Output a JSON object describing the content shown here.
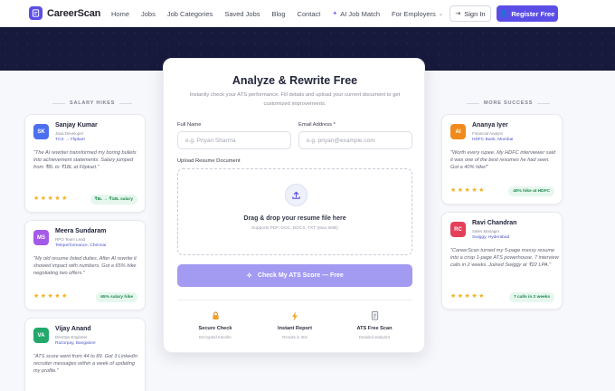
{
  "brand": {
    "name": "CareerScan"
  },
  "nav": {
    "links": [
      "Home",
      "Jobs",
      "Job Categories",
      "Saved Jobs",
      "Blog",
      "Contact",
      "AI Job Match",
      "For Employers"
    ],
    "sign_in": "Sign In",
    "register": "Register Free"
  },
  "left": {
    "heading": "SALARY HIKES",
    "cards": [
      {
        "initials": "SK",
        "name": "Sanjay Kumar",
        "role": "Java Developer",
        "company": "TCS → Flipkart",
        "quote": "\"The AI rewriter transformed my boring bullets into achievement statements. Salary jumped from ₹8L to ₹18L at Flipkart.\"",
        "stars": "★★★★★",
        "badge": "₹8L → ₹18L salary",
        "color": "#4c6ff0"
      },
      {
        "initials": "MS",
        "name": "Meera Sundaram",
        "role": "RPO Team Lead",
        "company": "Teleperformance, Chennai",
        "quote": "\"My old resume listed duties. After AI rewrite it showed impact with numbers. Got a 65% hike negotiating two offers.\"",
        "stars": "★★★★★",
        "badge": "65% salary hike",
        "color": "#a45ae8"
      },
      {
        "initials": "VA",
        "name": "Vijay Anand",
        "role": "DevOps Engineer",
        "company": "Razorpay, Bangalore",
        "quote": "\"ATS score went from 44 to 89. Got 3 LinkedIn recruiter messages within a week of updating my profile.\"",
        "color": "#22a86a"
      }
    ]
  },
  "right": {
    "heading": "MORE SUCCESS",
    "cards": [
      {
        "initials": "AI",
        "name": "Ananya Iyer",
        "role": "Financial Analyst",
        "company": "HDFC Bank, Mumbai",
        "quote": "\"Worth every rupee. My HDFC interviewer said it was one of the best resumes he had seen. Got a 40% hike!\"",
        "stars": "★★★★★",
        "badge": "40% hike at HDFC",
        "color": "#f08a1c"
      },
      {
        "initials": "RC",
        "name": "Ravi Chandran",
        "role": "Sales Manager",
        "company": "Swiggy, Hyderabad",
        "quote": "\"CareerScan turned my 5-page messy resume into a crisp 1-page ATS powerhouse. 7 interview calls in 2 weeks. Joined Swiggy at ₹22 LPA.\"",
        "stars": "★★★★★",
        "badge": "7 calls in 2 weeks",
        "color": "#e5405a"
      }
    ]
  },
  "form": {
    "title": "Analyze & Rewrite Free",
    "subtitle": "Instantly check your ATS performance. Fill details and upload your current document to get customized improvements.",
    "full_name_label": "Full Name",
    "full_name_placeholder": "e.g. Priyan Sharma",
    "email_label": "Email Address *",
    "email_placeholder": "e.g. priyan@example.com",
    "upload_label": "Upload Resume Document",
    "drop_title": "Drag & drop your resume file here",
    "drop_sub": "Supports PDF, DOC, DOCX, TXT (Max 5MB)",
    "cta": "Check My ATS Score — Free",
    "features": [
      {
        "icon": "lock-icon",
        "title": "Secure Check",
        "sub": "Encrypted transfer"
      },
      {
        "icon": "bolt-icon",
        "title": "Instant Report",
        "sub": "Results in 30s"
      },
      {
        "icon": "doc-icon",
        "title": "ATS Free Scan",
        "sub": "Detailed analytics"
      }
    ]
  }
}
